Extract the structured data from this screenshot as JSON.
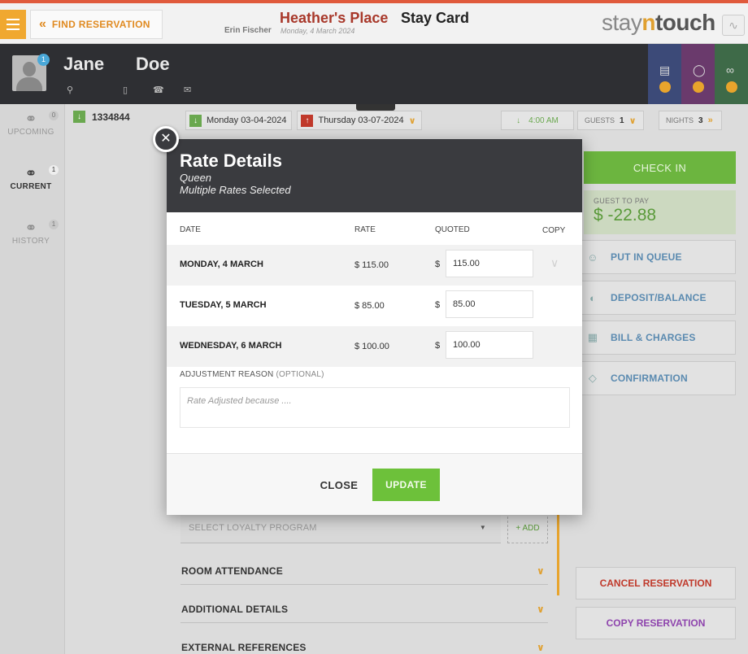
{
  "header": {
    "find_label": "FIND RESERVATION",
    "hotel_name": "Heather's Place",
    "page_name": "Stay Card",
    "user_name": "Erin Fischer",
    "business_date": "Monday, 4 March 2024",
    "logo_pre": "stay",
    "logo_n": "n",
    "logo_post": "touch"
  },
  "guest": {
    "first_name": "Jane",
    "last_name": "Doe",
    "avatar_badge": "1",
    "tile_colors": [
      "#3c4a78",
      "#6a3a6c",
      "#3e6a48"
    ]
  },
  "nav": {
    "items": [
      {
        "label": "UPCOMING",
        "count": "0"
      },
      {
        "label": "CURRENT",
        "count": "1"
      },
      {
        "label": "HISTORY",
        "count": "1"
      }
    ]
  },
  "reservation": {
    "number": "1334844",
    "arrival": "Monday 03-04-2024",
    "departure": "Thursday 03-07-2024",
    "time": "4:00 AM",
    "guests_label": "GUESTS",
    "guests_count": "1",
    "nights_label": "NIGHTS",
    "nights_count": "3"
  },
  "actions": {
    "check_in": "CHECK IN",
    "guest_to_pay_label": "GUEST TO PAY",
    "guest_to_pay_amount": "$ -22.88",
    "put_in_queue": "PUT IN QUEUE",
    "deposit_balance": "DEPOSIT/BALANCE",
    "bill_charges": "BILL & CHARGES",
    "confirmation": "CONFIRMATION",
    "cancel_reservation": "CANCEL RESERVATION",
    "copy_reservation": "COPY RESERVATION",
    "cancel_color": "#c0392b",
    "copy_color": "#8e44ad"
  },
  "details": {
    "loyalty_placeholder": "SELECT LOYALTY PROGRAM",
    "add_label": "+ ADD",
    "sections": [
      "ROOM ATTENDANCE",
      "ADDITIONAL DETAILS",
      "EXTERNAL REFERENCES"
    ]
  },
  "modal": {
    "title": "Rate Details",
    "room_type": "Queen",
    "subtitle": "Multiple Rates Selected",
    "columns": {
      "date": "DATE",
      "rate": "RATE",
      "quoted": "QUOTED",
      "copy": "COPY"
    },
    "currency": "$",
    "rows": [
      {
        "date": "MONDAY, 4 MARCH",
        "rate": "$ 115.00",
        "quoted": "115.00"
      },
      {
        "date": "TUESDAY, 5 MARCH",
        "rate": "$ 85.00",
        "quoted": "85.00"
      },
      {
        "date": "WEDNESDAY, 6 MARCH",
        "rate": "$ 100.00",
        "quoted": "100.00"
      }
    ],
    "adjustment_label": "ADJUSTMENT REASON",
    "adjustment_optional": "(OPTIONAL)",
    "adjustment_placeholder": "Rate Adjusted because ....",
    "close_label": "CLOSE",
    "update_label": "UPDATE"
  }
}
